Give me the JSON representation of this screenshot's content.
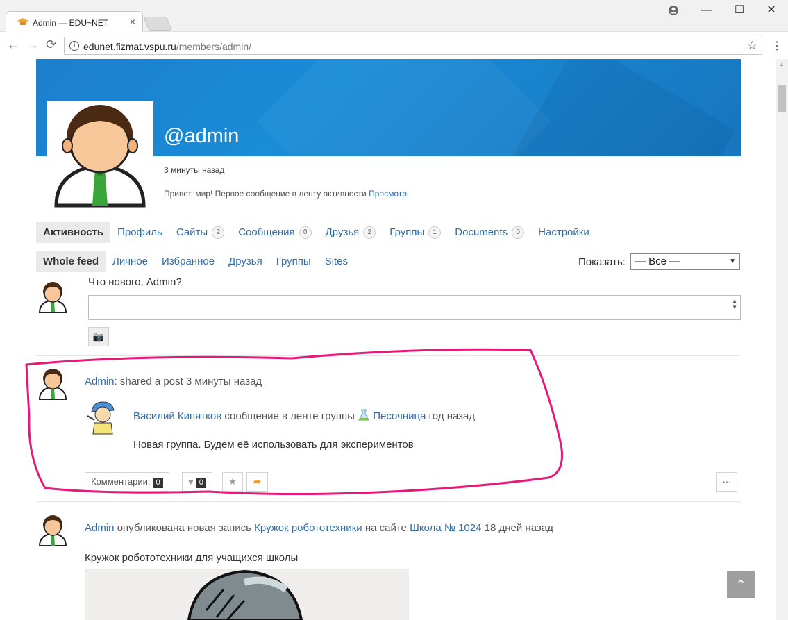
{
  "browser": {
    "tab_title": "Admin — EDU~NET",
    "tab_close": "×",
    "url_host": "edunet.fizmat.vspu.ru",
    "url_path": "/members/admin/",
    "info_icon": "i",
    "back_icon": "←",
    "forward_icon": "→",
    "reload_icon": "⟳",
    "star_icon": "☆",
    "menu_icon": "⋮",
    "minimize_icon": "—",
    "maximize_icon": "☐",
    "close_icon": "✕"
  },
  "profile": {
    "handle": "@admin",
    "last_active": "3 минуты назад",
    "status_text": "Привет, мир! Первое сообщение в ленту активности",
    "status_link": "Просмотр"
  },
  "main_nav": [
    {
      "label": "Активность",
      "count": null,
      "active": true
    },
    {
      "label": "Профиль",
      "count": null
    },
    {
      "label": "Сайты",
      "count": "2"
    },
    {
      "label": "Сообщения",
      "count": "0"
    },
    {
      "label": "Друзья",
      "count": "2"
    },
    {
      "label": "Группы",
      "count": "1"
    },
    {
      "label": "Documents",
      "count": "0"
    },
    {
      "label": "Настройки",
      "count": null
    }
  ],
  "sub_nav": [
    {
      "label": "Whole feed",
      "active": true
    },
    {
      "label": "Личное"
    },
    {
      "label": "Избранное"
    },
    {
      "label": "Друзья"
    },
    {
      "label": "Группы"
    },
    {
      "label": "Sites"
    }
  ],
  "filter": {
    "label": "Показать:",
    "selected": "— Все —",
    "arrow": "▼"
  },
  "post_form": {
    "prompt": "Что нового, Admin?",
    "camera_icon": "📷"
  },
  "activities": [
    {
      "author": "Admin",
      "action": ": shared a post 3 минуты назад",
      "inner_author": "Василий Кипятков",
      "inner_action": " сообщение в ленте группы ",
      "group": "Песочница",
      "inner_time": " год назад",
      "content": "Новая группа. Будем её использовать для экспериментов",
      "comments_label": "Комментарии:",
      "comments_count": "0",
      "likes_count": "0",
      "more": "···"
    },
    {
      "author": "Admin",
      "action": " опубликована новая запись ",
      "post_link": "Кружок робототехники",
      "on_site": " на сайте ",
      "site_link": "Школа № 1024",
      "time": " 18 дней назад",
      "content": "Кружок робототехники для учащихся школы"
    }
  ],
  "to_top_icon": "⌃",
  "colors": {
    "link": "#2f6ca8",
    "cover": "#1a8cd8",
    "highlight": "#e6197a"
  }
}
